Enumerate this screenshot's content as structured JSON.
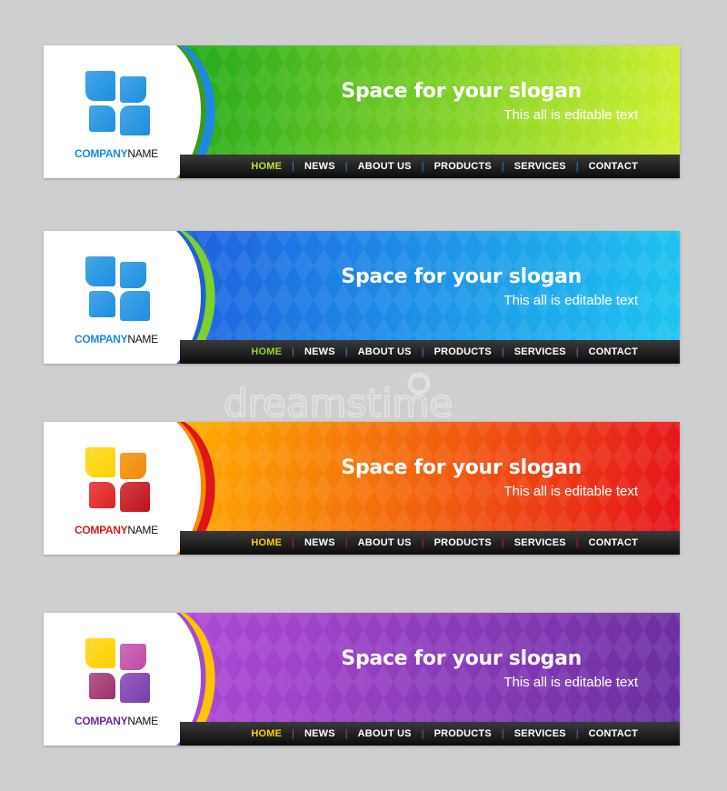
{
  "banners": [
    {
      "company_prefix": "COMPANY",
      "company_suffix": "NAME",
      "slogan": "Space for your slogan",
      "subtext": "This all is editable text",
      "nav": [
        "HOME",
        "NEWS",
        "ABOUT US",
        "PRODUCTS",
        "SERVICES",
        "CONTACT"
      ],
      "colors": {
        "bg_start": "#1fa81a",
        "bg_end": "#d4f232",
        "curve_outer": "#1e88e5",
        "curve_inner": "#3d9b1a",
        "active": "#b7e53a",
        "sep": "#1e88e5",
        "company": "#1e88e5",
        "logo": [
          "#1a8fe0",
          "#1a8fe0",
          "#1a8fe0",
          "#1a8fe0"
        ]
      }
    },
    {
      "company_prefix": "COMPANY",
      "company_suffix": "NAME",
      "slogan": "Space for your slogan",
      "subtext": "This all is editable text",
      "nav": [
        "HOME",
        "NEWS",
        "ABOUT US",
        "PRODUCTS",
        "SERVICES",
        "CONTACT"
      ],
      "colors": {
        "bg_start": "#1e5fe0",
        "bg_end": "#1ec6f0",
        "curve_outer": "#7cd12a",
        "curve_inner": "#1e60d8",
        "active": "#8fd62a",
        "sep": "#1e88e5",
        "company": "#1e88e5",
        "logo": [
          "#1a8fe0",
          "#1a8fe0",
          "#1a8fe0",
          "#1a8fe0"
        ]
      }
    },
    {
      "company_prefix": "COMPANY",
      "company_suffix": "NAME",
      "slogan": "Space for your slogan",
      "subtext": "This all is editable text",
      "nav": [
        "HOME",
        "NEWS",
        "ABOUT US",
        "PRODUCTS",
        "SERVICES",
        "CONTACT"
      ],
      "colors": {
        "bg_start": "#ffb000",
        "bg_end": "#e5121c",
        "curve_outer": "#e0141c",
        "curve_inner": "#f58a00",
        "active": "#ffcc00",
        "sep": "#e0141c",
        "company": "#d41a20",
        "logo": [
          "#ffd200",
          "#f28a00",
          "#e02020",
          "#c0121a"
        ]
      }
    },
    {
      "company_prefix": "COMPANY",
      "company_suffix": "NAME",
      "slogan": "Space for your slogan",
      "subtext": "This all is editable text",
      "nav": [
        "HOME",
        "NEWS",
        "ABOUT US",
        "PRODUCTS",
        "SERVICES",
        "CONTACT"
      ],
      "colors": {
        "bg_start": "#b04ad8",
        "bg_end": "#6a2ea0",
        "curve_outer": "#ffc400",
        "curve_inner": "#a24bd2",
        "active": "#ffcc00",
        "sep": "#8a4ac0",
        "company": "#6a2a90",
        "logo": [
          "#ffd000",
          "#c04aa8",
          "#a0306c",
          "#7a3ab0"
        ]
      }
    }
  ]
}
